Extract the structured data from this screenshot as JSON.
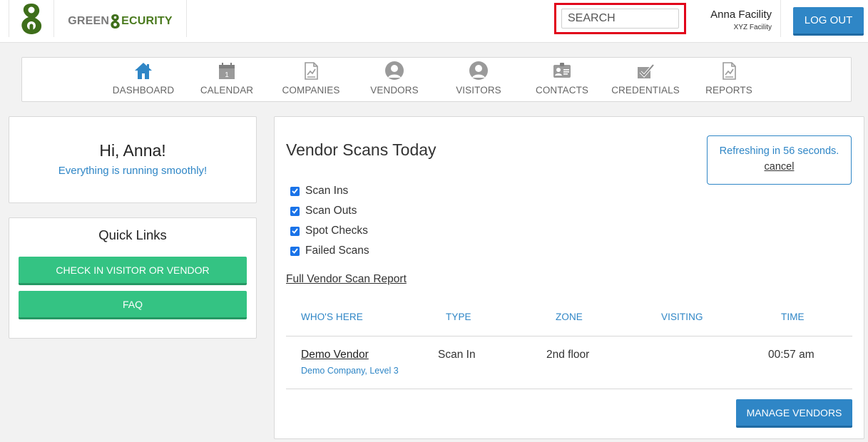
{
  "header": {
    "brand_left": "GREEN",
    "brand_right": "ECURITY",
    "search_placeholder": "SEARCH",
    "user_name": "Anna Facility",
    "user_org": "XYZ Facility",
    "logout_label": "LOG OUT",
    "brand_color": "#4a7a1e"
  },
  "nav": {
    "items": [
      {
        "label": "DASHBOARD",
        "icon": "home-icon"
      },
      {
        "label": "CALENDAR",
        "icon": "calendar-icon"
      },
      {
        "label": "COMPANIES",
        "icon": "document-chart-icon"
      },
      {
        "label": "VENDORS",
        "icon": "person-icon"
      },
      {
        "label": "VISITORS",
        "icon": "person-icon"
      },
      {
        "label": "CONTACTS",
        "icon": "id-card-icon"
      },
      {
        "label": "CREDENTIALS",
        "icon": "checkmark-icon"
      },
      {
        "label": "REPORTS",
        "icon": "document-chart-icon"
      }
    ],
    "active_color": "#2f86c6",
    "inactive_color": "#8a8a8a"
  },
  "greeting": {
    "title": "Hi, Anna!",
    "subtitle": "Everything is running smoothly!"
  },
  "quick_links": {
    "title": "Quick Links",
    "checkin_label": "CHECK IN VISITOR OR VENDOR",
    "faq_label": "FAQ",
    "button_color": "#34c383"
  },
  "main": {
    "title": "Vendor Scans Today",
    "refresh_text": "Refreshing in 56 seconds.",
    "refresh_cancel": "cancel",
    "filters": [
      {
        "label": "Scan Ins",
        "checked": true
      },
      {
        "label": "Scan Outs",
        "checked": true
      },
      {
        "label": "Spot Checks",
        "checked": true
      },
      {
        "label": "Failed Scans",
        "checked": true
      }
    ],
    "full_report_link": "Full Vendor Scan Report",
    "table": {
      "headers": [
        "WHO'S HERE",
        "TYPE",
        "ZONE",
        "VISITING",
        "TIME"
      ],
      "rows": [
        {
          "name": "Demo Vendor",
          "company": "Demo Company, Level 3",
          "type": "Scan In",
          "zone": "2nd floor",
          "visiting": "",
          "time": "00:57 am"
        }
      ]
    },
    "manage_label": "MANAGE VENDORS",
    "accent_color": "#2f86c6"
  }
}
